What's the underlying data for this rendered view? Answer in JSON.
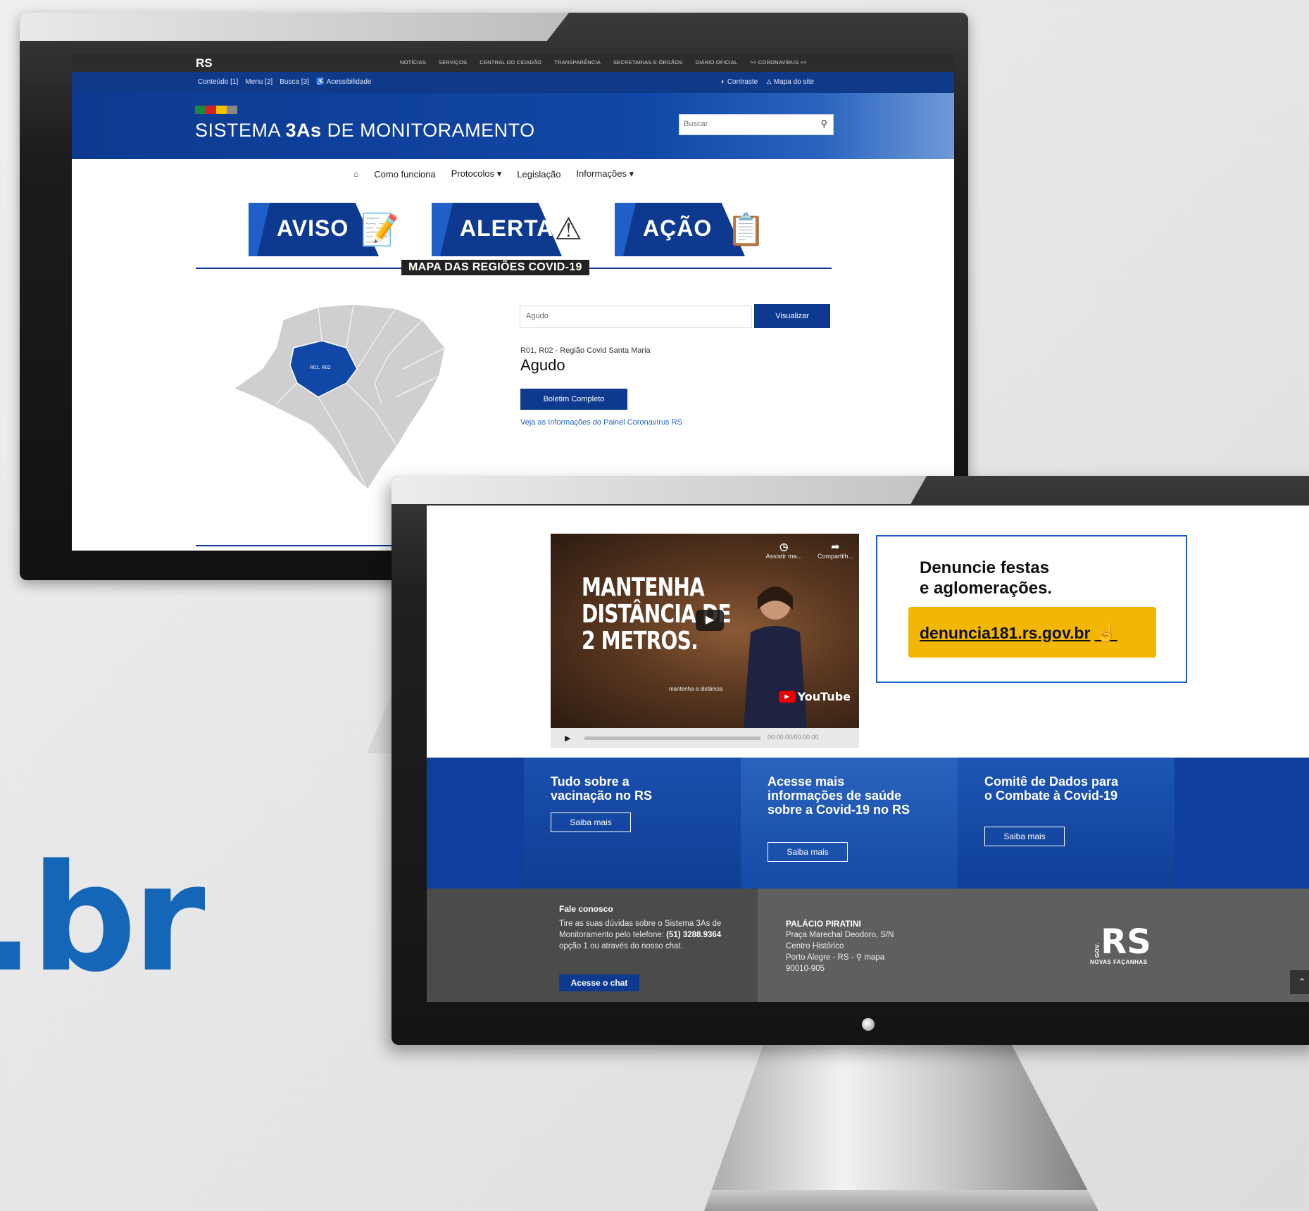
{
  "brand_text": ".br",
  "back_site": {
    "logo": "RS",
    "top_nav": [
      "NOTÍCIAS",
      "SERVIÇOS",
      "CENTRAL DO CIDADÃO",
      "TRANSPARÊNCIA",
      "SECRETARIAS E ÓRGÃOS",
      "DIÁRIO OFICIAL",
      ">> CORONAVÍRUS <<"
    ],
    "accessibility_links": [
      "Conteúdo [1]",
      "Menu [2]",
      "Busca [3]",
      "♿ Acessibilidade"
    ],
    "contrast_label": "◐ Contraste",
    "sitemap_label": "⛼ Mapa do site",
    "title_prefix": "SISTEMA ",
    "title_bold": "3As",
    "title_suffix": " DE MONITORAMENTO",
    "search_placeholder": "Buscar",
    "main_nav": {
      "home": "⌂",
      "items": [
        "Como funciona",
        "Protocolos ▾",
        "Legislação",
        "Informações ▾"
      ]
    },
    "cards": [
      {
        "label": "AVISO",
        "icon": "📝"
      },
      {
        "label": "ALERTA",
        "icon": "⚠"
      },
      {
        "label": "AÇÃO",
        "icon": "📋"
      }
    ],
    "section_title": "MAPA DAS REGIÕES COVID-19",
    "map_labels": [
      "R01, R02"
    ],
    "municipality_value": "Agudo",
    "view_button": "Visualizar",
    "region_text": "R01, R02 - Região Covid Santa Maria",
    "city_name": "Agudo",
    "bulletin_button": "Boletim Completo",
    "panel_link": "Veja as Informações do Painel Coronavírus RS"
  },
  "front_site": {
    "video": {
      "caption_lines": [
        "MANTENHA",
        "DISTÂNCIA DE",
        "2 METROS."
      ],
      "watch_later": "Assistir ma...",
      "share": "Compartilh...",
      "subtitle": "mantenha a distância",
      "youtube": "YouTube",
      "time": "00:00:00/00:00:00"
    },
    "report": {
      "title_lines": [
        "Denuncie festas",
        "e aglomerações."
      ],
      "link": "denuncia181.rs.gov.br"
    },
    "promos": [
      {
        "title": "Tudo sobre a vacinação no RS",
        "button": "Saiba mais"
      },
      {
        "title": "Acesse mais informações de saúde sobre a Covid-19 no RS",
        "button": "Saiba mais"
      },
      {
        "title": "Comitê de Dados para o Combate à Covid-19",
        "button": "Saiba mais"
      }
    ],
    "footer": {
      "contact_title": "Fale conosco",
      "contact_text": "Tire as suas dúvidas sobre o Sistema 3As de Monitoramento pelo telefone:",
      "phone": "(51) 3288.9364",
      "contact_text_2": "opção 1 ou através do nosso chat.",
      "chat_button": "Acesse o chat",
      "palace_title": "PALÁCIO PIRATINI",
      "address_lines": [
        "Praça Marechal Deodoro, S/N",
        "Centro Histórico",
        "Porto Alegre - RS - ⚲ mapa",
        "90010-905"
      ],
      "logo_prefix": "GOV.",
      "logo": "RS",
      "logo_tagline": "NOVAS FAÇANHAS",
      "scroll_top": "⌃"
    }
  },
  "colors": {
    "brand_blue": "#1565b8",
    "navy": "#0d3a8f",
    "yellow": "#f2b705"
  }
}
